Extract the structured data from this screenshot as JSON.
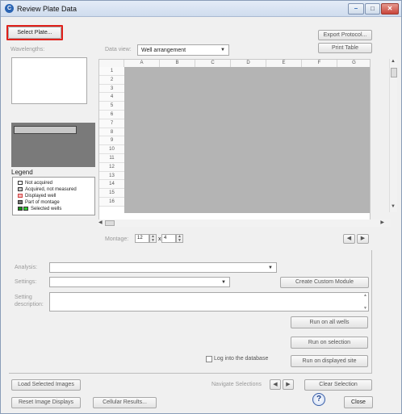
{
  "window": {
    "title": "Review Plate Data",
    "app_icon_glyph": "C",
    "minimize_glyph": "–",
    "maximize_glyph": "□",
    "close_glyph": "✕"
  },
  "toolbar": {
    "select_plate": "Select Plate...",
    "export_protocol": "Export Protocol...",
    "print_table": "Print Table"
  },
  "labels": {
    "wavelengths": "Wavelengths:",
    "data_view": "Data view:",
    "legend": "Legend",
    "montage": "Montage:",
    "montage_x": "x",
    "analysis": "Analysis:",
    "settings": "Settings:",
    "setting_description": "Setting\ndescription:"
  },
  "data_view": {
    "selected": "Well arrangement"
  },
  "plate": {
    "columns": [
      "A",
      "B",
      "C",
      "D",
      "E",
      "F",
      "G"
    ],
    "rows": [
      "1",
      "2",
      "3",
      "4",
      "5",
      "6",
      "7",
      "8",
      "9",
      "10",
      "11",
      "12",
      "13",
      "14",
      "15",
      "16"
    ]
  },
  "legend": {
    "items": [
      {
        "label": "Not acquired",
        "color": "#ffffff"
      },
      {
        "label": "Acquired, not measured",
        "color": "#c8c8c8"
      },
      {
        "label": "Displayed well",
        "color": "#f4b7b7"
      },
      {
        "label": "Part of montage",
        "color": "#777777"
      },
      {
        "label": "Selected wells",
        "color": "#32cd32"
      }
    ]
  },
  "montage": {
    "cols": "12",
    "rows": "4"
  },
  "buttons": {
    "create_custom_module": "Create Custom Module",
    "run_all_wells": "Run on all wells",
    "run_selection": "Run on selection",
    "run_displayed_site": "Run on displayed site",
    "log_database": "Log into the database",
    "load_selected_images": "Load Selected Images",
    "reset_image_displays": "Reset Image Displays",
    "cellular_results": "Cellular Results...",
    "navigate_selections": "Navigate Selections",
    "clear_selection": "Clear Selection",
    "close": "Close",
    "help_glyph": "?"
  },
  "colors": {
    "highlight": "#e0201a",
    "plate_fill": "#b4b4b4"
  }
}
